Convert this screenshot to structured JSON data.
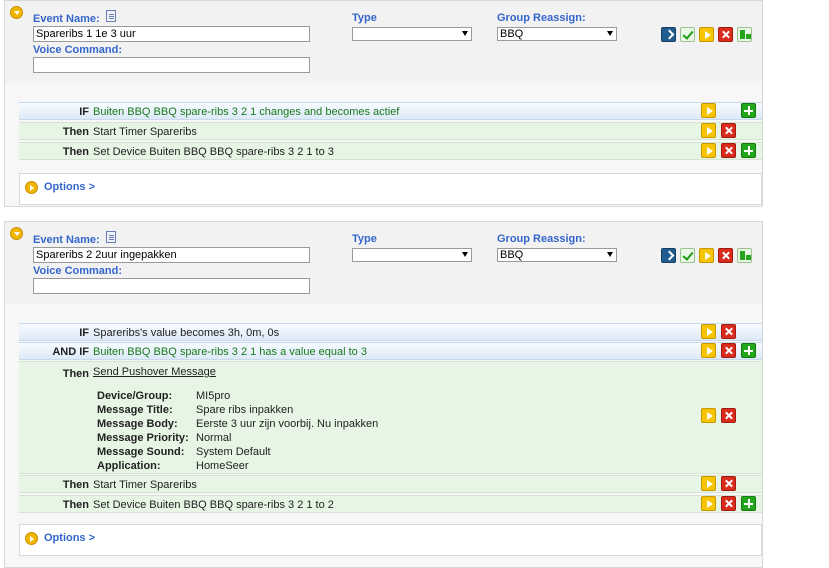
{
  "labels": {
    "event_name": "Event Name:",
    "type": "Type",
    "group_reassign": "Group Reassign:",
    "voice_command": "Voice Command:",
    "if": "IF",
    "and_if": "AND IF",
    "then": "Then",
    "options": "Options >"
  },
  "events": [
    {
      "name": "Spareribs 1 1e 3 uur",
      "type_value": "",
      "group_value": "BBQ",
      "voice_command": "",
      "conditions": [
        {
          "kw": "IF",
          "text": "Buiten BBQ BBQ spare-ribs 3 2 1 changes and becomes actief"
        }
      ],
      "actions": [
        {
          "kw": "Then",
          "text": "Start Timer Spareribs"
        },
        {
          "kw": "Then",
          "text": "Set Device Buiten BBQ BBQ spare-ribs 3 2 1 to 3"
        }
      ]
    },
    {
      "name": "Spareribs 2 2uur ingepakken",
      "type_value": "",
      "group_value": "BBQ",
      "voice_command": "",
      "conditions": [
        {
          "kw": "IF",
          "text": "Spareribs's value becomes 3h, 0m, 0s"
        },
        {
          "kw": "AND IF",
          "text": "Buiten BBQ BBQ spare-ribs 3 2 1 has a value equal to 3"
        }
      ],
      "pushover": {
        "kw": "Then",
        "title": "Send Pushover Message",
        "fields": [
          {
            "label": "Device/Group:",
            "value": "MI5pro"
          },
          {
            "label": "Message Title:",
            "value": "Spare ribs inpakken"
          },
          {
            "label": "Message Body:",
            "value": "Eerste 3 uur zijn voorbij. Nu inpakken"
          },
          {
            "label": "Message Priority:",
            "value": "Normal"
          },
          {
            "label": "Message Sound:",
            "value": "System Default"
          },
          {
            "label": "Application:",
            "value": "HomeSeer"
          }
        ]
      },
      "actions": [
        {
          "kw": "Then",
          "text": "Start Timer Spareribs"
        },
        {
          "kw": "Then",
          "text": "Set Device Buiten BBQ BBQ spare-ribs 3 2 1 to 2"
        }
      ]
    }
  ],
  "colors": {
    "label_blue": "#3366cc",
    "condition_green": "#1a7a1a",
    "then_row_bg": "#e6f5e4",
    "if_row_bg": "#dde9f8"
  },
  "icons": [
    "collapse-icon",
    "notes-icon",
    "run-icon",
    "save-icon",
    "test-icon",
    "delete-icon",
    "add-icon",
    "group-icon",
    "expand-icon"
  ]
}
